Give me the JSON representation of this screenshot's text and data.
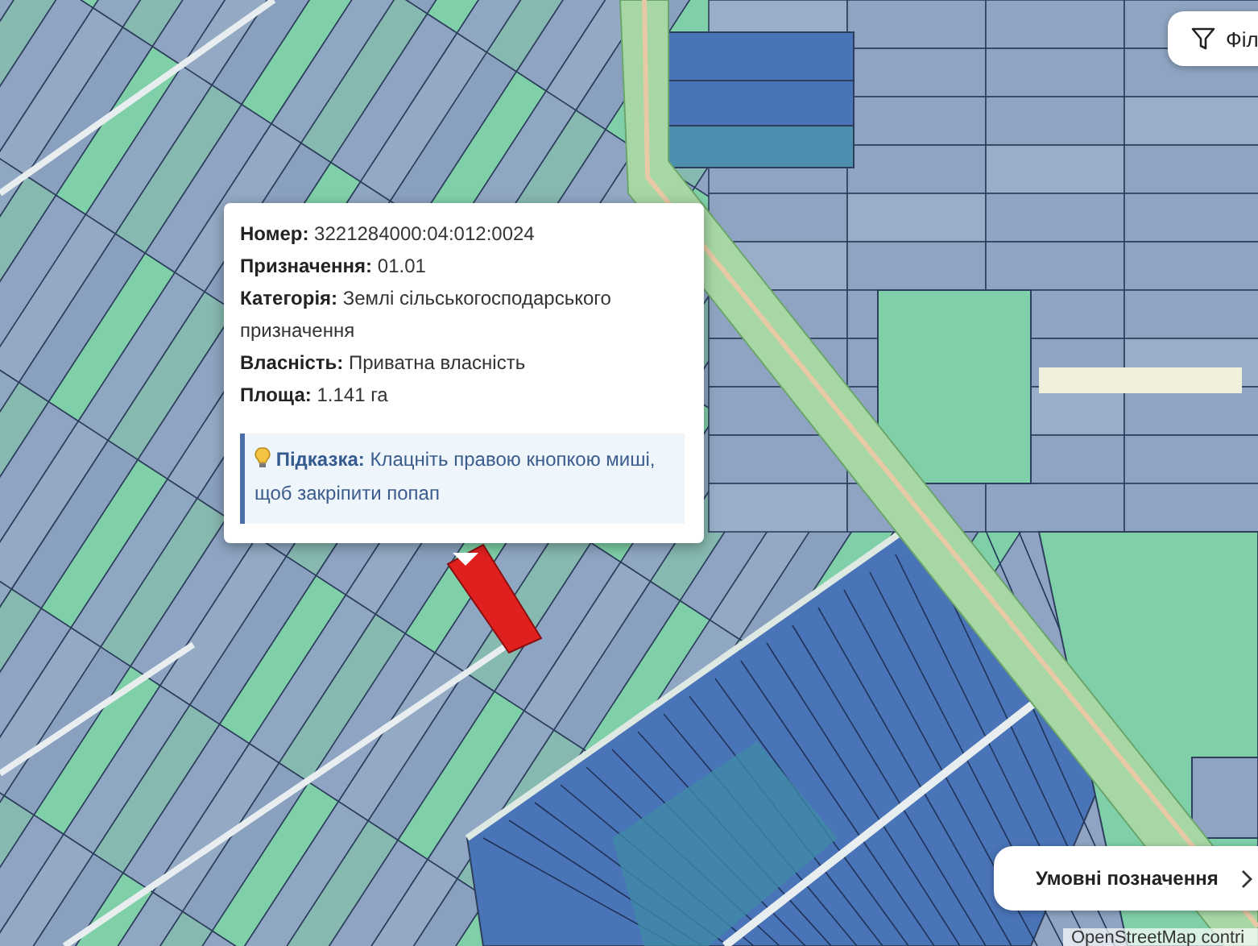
{
  "filter_button": {
    "label": "Філ"
  },
  "popup": {
    "fields": [
      {
        "text": "**Номер:** 3221284000:04:012:0024"
      },
      {
        "text": "**Призначення:** 01.01"
      },
      {
        "text": "**Категорія:** Землі сільськогосподарського призначення"
      },
      {
        "text": "**Власність:** Приватна власність"
      },
      {
        "text": "**Площа:** 1.141 га"
      }
    ],
    "hint": {
      "text": "**Підказка:** Клацніть правою кнопкою миші, щоб закріпити попап"
    }
  },
  "legend_button": {
    "label": "Умовні позначення"
  },
  "attribution": "OpenStreetMap contri"
}
